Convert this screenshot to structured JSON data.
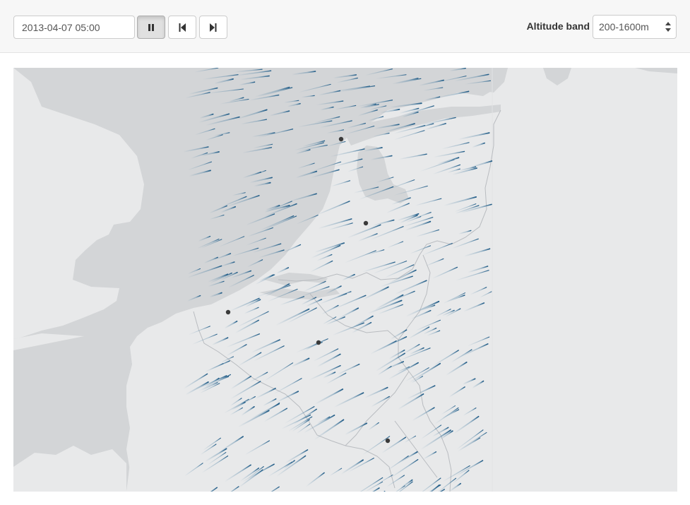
{
  "toolbar": {
    "datetime_value": "2013-04-07 05:00",
    "play_pause_icon": "pause-icon",
    "step_back_icon": "skip-back-icon",
    "step_forward_icon": "skip-forward-icon",
    "altitude_label": "Altitude band",
    "altitude_selected": "200-1600m",
    "altitude_caret_icon": "select-caret-icon"
  },
  "map": {
    "colors": {
      "sea": "#d3d5d7",
      "land": "#e8e9ea",
      "border": "#b9bcc0",
      "flow": "#2b6a95",
      "radar": "#3a3a3a"
    },
    "radar_station_count": 5
  }
}
